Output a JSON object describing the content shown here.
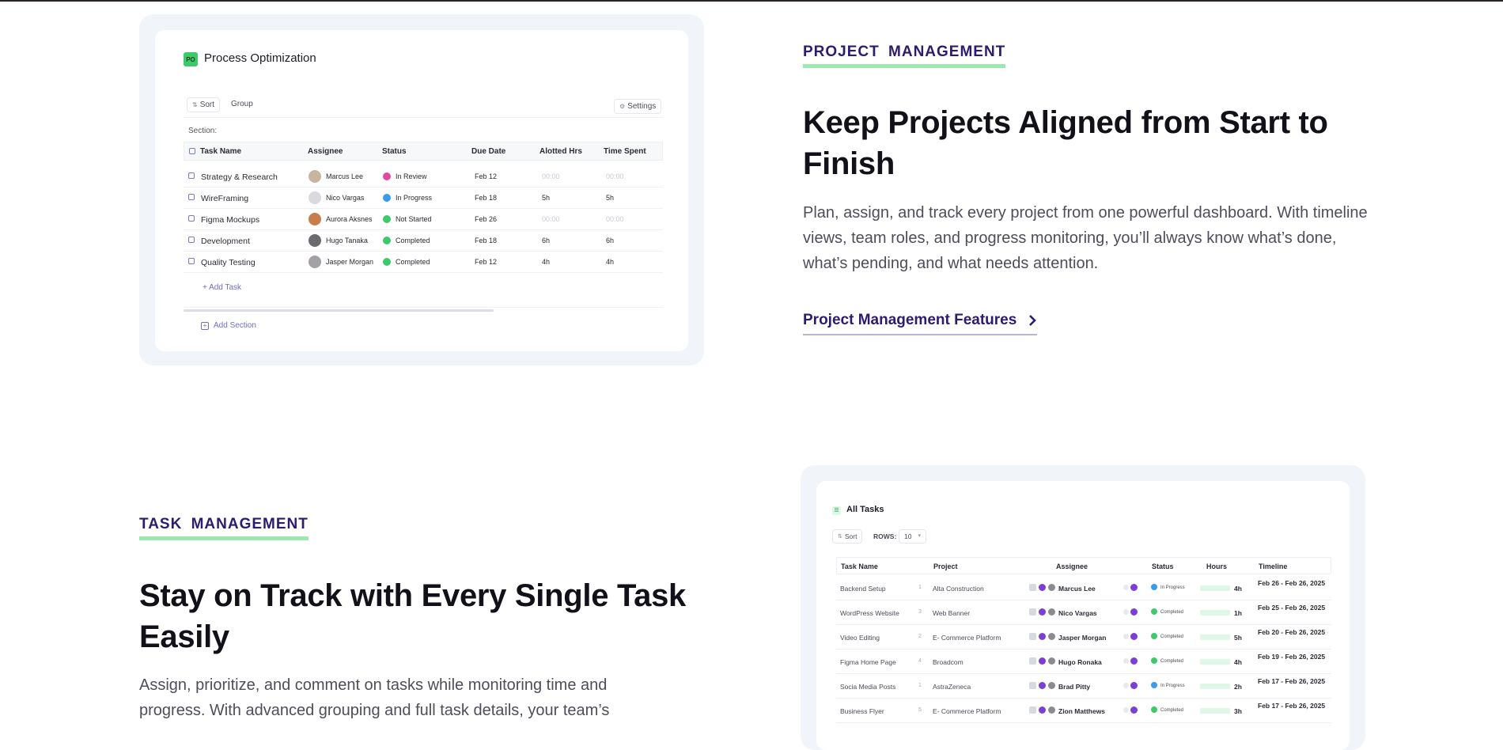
{
  "section1": {
    "eyebrow": "PROJECT MANAGEMENT",
    "title": "Keep Projects Aligned from Start to Finish",
    "paragraph": "Plan, assign, and track every project from one powerful dashboard. With timeline views, team roles, and progress monitoring, you’ll always know what’s done, what’s pending, and what needs attention.",
    "link_label": "Project Management Features",
    "card": {
      "badge": "PO",
      "title": "Process Optimization",
      "sort_label": "Sort",
      "group_label": "Group",
      "settings_label": "Settings",
      "section_label": "Section:",
      "columns": [
        "Task Name",
        "Assignee",
        "Status",
        "Due Date",
        "Alotted Hrs",
        "Time Spent"
      ],
      "rows": [
        {
          "task": "Strategy & Research",
          "assignee": "Marcus Lee",
          "status": "In Review",
          "status_color": "#e04ba0",
          "due": "Feb 12",
          "alotted": "00:00",
          "spent": "00:00",
          "avatar_color": "#c8b5a0"
        },
        {
          "task": "WireFraming",
          "assignee": "Nico Vargas",
          "status": "In Progress",
          "status_color": "#3a9be8",
          "due": "Feb 18",
          "alotted": "5h",
          "spent": "5h",
          "avatar_color": "#d9d9de"
        },
        {
          "task": "Figma Mockups",
          "assignee": "Aurora Aksnes",
          "status": "Not Started",
          "status_color": "#3fc96a",
          "due": "Feb 26",
          "alotted": "00:00",
          "spent": "00:00",
          "avatar_color": "#c97d4a"
        },
        {
          "task": "Development",
          "assignee": "Hugo Tanaka",
          "status": "Completed",
          "status_color": "#3fc96a",
          "due": "Feb 18",
          "alotted": "6h",
          "spent": "6h",
          "avatar_color": "#6d6a70"
        },
        {
          "task": "Quality Testing",
          "assignee": "Jasper Morgan",
          "status": "Completed",
          "status_color": "#3fc96a",
          "due": "Feb 12",
          "alotted": "4h",
          "spent": "4h",
          "avatar_color": "#a3a0a6"
        }
      ],
      "add_task": "+ Add Task",
      "add_section": "Add Section"
    }
  },
  "section2": {
    "eyebrow": "TASK MANAGEMENT",
    "title": "Stay on Track with Every Single Task Easily",
    "paragraph": "Assign, prioritize, and comment on tasks while monitoring time and progress. With advanced grouping and full task details, your team’s",
    "card": {
      "title": "All Tasks",
      "sort_label": "Sort",
      "rows_label": "ROWS:",
      "rows_value": "10",
      "columns": [
        "Task Name",
        "Project",
        "Assignee",
        "Status",
        "Hours",
        "Timeline"
      ],
      "rows": [
        {
          "task": "Backend Setup",
          "num": "1",
          "project": "Alta Construction",
          "assignee": "Marcus Lee",
          "status": "In Progress",
          "status_color": "#3a9be8",
          "hours": "4h",
          "timeline": "Feb 26 - Feb 26, 2025"
        },
        {
          "task": "WordPress Website",
          "num": "3",
          "project": "Web Banner",
          "assignee": "Nico Vargas",
          "status": "Completed",
          "status_color": "#3fc96a",
          "hours": "1h",
          "timeline": "Feb 25 - Feb 26, 2025"
        },
        {
          "task": "Video Editing",
          "num": "2",
          "project": "E- Commerce Platform",
          "assignee": "Jasper Morgan",
          "status": "Completed",
          "status_color": "#3fc96a",
          "hours": "5h",
          "timeline": "Feb 20 - Feb 26, 2025"
        },
        {
          "task": "Figma Home Page",
          "num": "4",
          "project": "Broadcom",
          "assignee": "Hugo Ronaka",
          "status": "Completed",
          "status_color": "#3fc96a",
          "hours": "4h",
          "timeline": "Feb 19 - Feb 26, 2025"
        },
        {
          "task": "Socia Media Posts",
          "num": "1",
          "project": "AstraZeneca",
          "assignee": "Brad Pitty",
          "status": "In Progress",
          "status_color": "#3a9be8",
          "hours": "2h",
          "timeline": "Feb 17 - Feb 26, 2025"
        },
        {
          "task": "Business Flyer",
          "num": "5",
          "project": "E- Commerce Platform",
          "assignee": "Zion Matthews",
          "status": "Completed",
          "status_color": "#3fc96a",
          "hours": "3h",
          "timeline": "Feb 17 - Feb 26, 2025"
        }
      ]
    }
  },
  "icons": {
    "sort": "sort-icon",
    "settings": "gear-icon",
    "chevron": "chevron-right-icon"
  }
}
